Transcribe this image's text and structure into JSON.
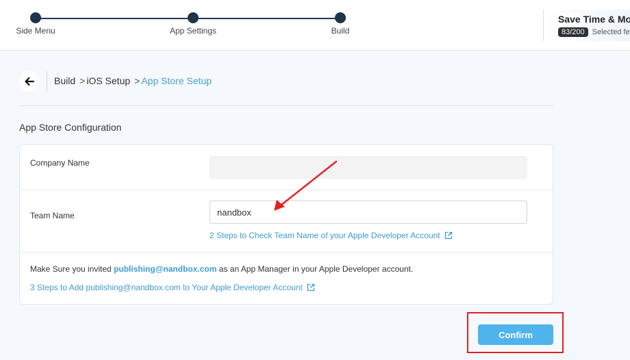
{
  "stepper": {
    "steps": [
      {
        "label": "Side Menu"
      },
      {
        "label": "App Settings"
      },
      {
        "label": "Build"
      }
    ]
  },
  "promo": {
    "title": "Save Time & More",
    "badge": "83/200",
    "subtitle": "Selected fe"
  },
  "breadcrumb": {
    "items": [
      "Build",
      "iOS Setup",
      "App Store Setup"
    ],
    "separator": ">"
  },
  "section": {
    "title": "App Store Configuration"
  },
  "form": {
    "company_name": {
      "label": "Company Name",
      "value": ""
    },
    "team_name": {
      "label": "Team Name",
      "value": "nandbox"
    },
    "team_help_link": "2 Steps to Check Team Name of your Apple Developer Account",
    "notice": {
      "prefix": "Make Sure you invited ",
      "email": "publishing@nandbox.com",
      "suffix": " as an App Manager in your Apple Developer account."
    },
    "invite_help_link": "3 Steps to Add publishing@nandbox.com to Your Apple Developer Account"
  },
  "actions": {
    "confirm_label": "Confirm"
  },
  "colors": {
    "accent": "#4fb3ec",
    "link": "#3d9bd3",
    "highlight": "#e02020",
    "stepper": "#1f3349"
  },
  "icons": {
    "back": "arrow-left-icon",
    "external": "external-link-icon"
  }
}
